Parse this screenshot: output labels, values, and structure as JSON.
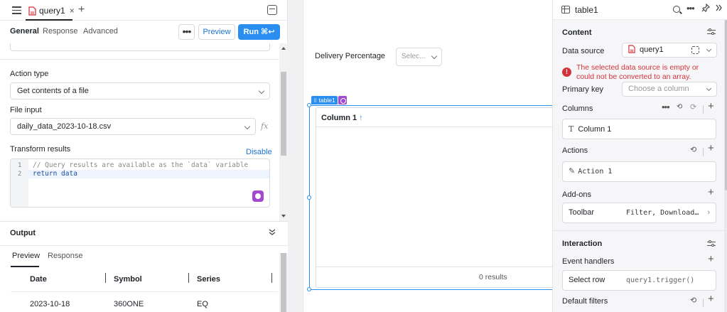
{
  "left": {
    "tab": {
      "name": "query1",
      "close": "×",
      "add": "+"
    },
    "subtabs": [
      "General",
      "Response",
      "Advanced"
    ],
    "buttons": {
      "more": "•••",
      "preview": "Preview",
      "run": "Run ⌘↩"
    },
    "action_type": {
      "label": "Action type",
      "value": "Get contents of a file"
    },
    "file_input": {
      "label": "File input",
      "value": "daily_data_2023-10-18.csv",
      "fx": "fx"
    },
    "transform": {
      "label": "Transform results",
      "toggle": "Disable",
      "line_numbers": [
        "1",
        "2"
      ],
      "lines": [
        "// Query results are available as the `data` variable",
        "return data"
      ]
    },
    "output": {
      "title": "Output",
      "collapse": "⌄",
      "tabs": [
        "Preview",
        "Response"
      ],
      "columns": [
        "Date",
        "Symbol",
        "Series"
      ],
      "rows": [
        [
          "2023-10-18",
          "360ONE",
          "EQ"
        ]
      ]
    }
  },
  "canvas": {
    "select_label": "Delivery Percentage",
    "select_placeholder": "Selec...",
    "table_tag": "table1",
    "column_header": "Column 1",
    "sort_arrow": "↑",
    "results": "0 results"
  },
  "inspector": {
    "title": "table1",
    "content": {
      "title": "Content",
      "data_source_label": "Data source",
      "data_source_value": "query1",
      "error": "The selected data source is empty or could not be converted to an array.",
      "primary_key_label": "Primary key",
      "primary_key_placeholder": "Choose a column",
      "columns_label": "Columns",
      "column_item": "Column 1",
      "actions_label": "Actions",
      "action_item": "Action 1",
      "addons_label": "Add-ons",
      "toolbar_label": "Toolbar",
      "toolbar_value": "Filter, Download…"
    },
    "interaction": {
      "title": "Interaction",
      "event_handlers_label": "Event handlers",
      "event_name": "Select row",
      "event_value": "query1.trigger()",
      "default_filters_label": "Default filters"
    }
  },
  "colors": {
    "accent": "#2a8ef0",
    "error": "#d2333a",
    "ai": "#a14ad0"
  }
}
